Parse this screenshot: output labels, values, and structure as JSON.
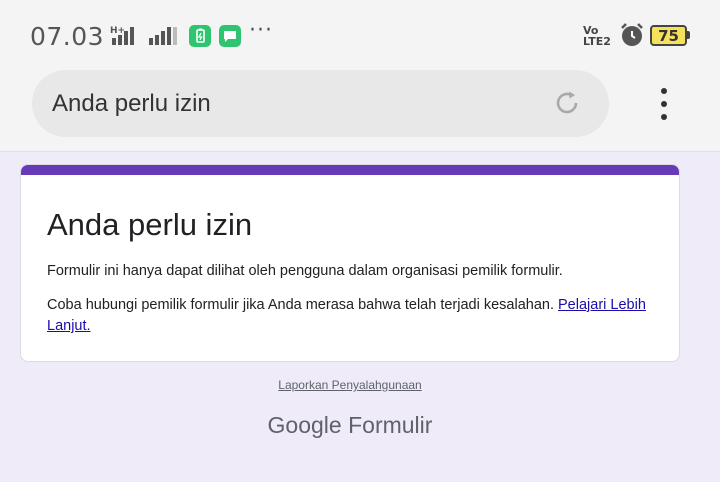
{
  "status_bar": {
    "time": "07.03",
    "network_a": "H+",
    "volte_top": "Vo",
    "volte_bottom": "LTE2",
    "battery": "75",
    "more": "···"
  },
  "browser": {
    "url_text": "Anda perlu izin",
    "reload_icon": "reload-icon",
    "menu_icon": "more-vert-icon"
  },
  "card": {
    "accent_color": "#673ab7",
    "title": "Anda perlu izin",
    "line1": "Formulir ini hanya dapat dilihat oleh pengguna dalam organisasi pemilik formulir.",
    "line2": "Coba hubungi pemilik formulir jika Anda merasa bahwa telah terjadi kesalahan.",
    "learn_more": "Pelajari Lebih Lanjut."
  },
  "footer": {
    "report": "Laporkan Penyalahgunaan",
    "brand_google": "Google",
    "brand_product": "Formulir"
  }
}
